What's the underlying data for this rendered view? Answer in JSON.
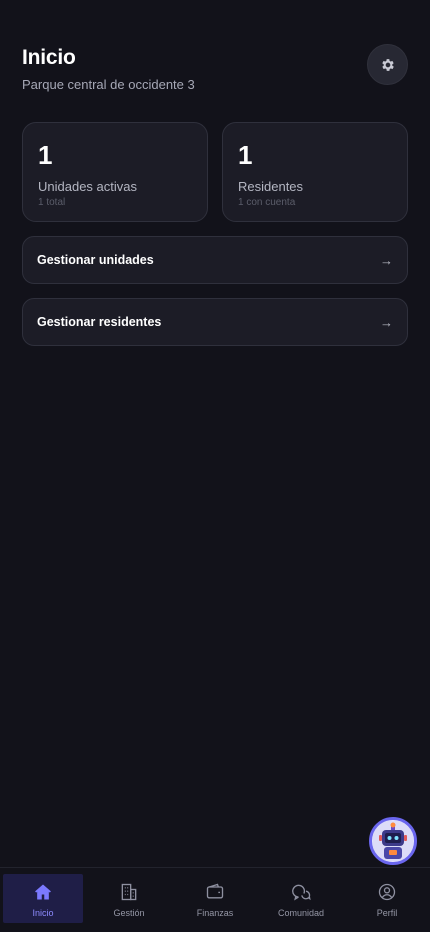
{
  "header": {
    "title": "Inicio",
    "subtitle": "Parque central de occidente 3",
    "settings_icon": "gear-icon"
  },
  "stats": [
    {
      "value": "1",
      "label": "Unidades activas",
      "sub": "1 total"
    },
    {
      "value": "1",
      "label": "Residentes",
      "sub": "1 con cuenta"
    }
  ],
  "actions": [
    {
      "label": "Gestionar unidades",
      "arrow": "→"
    },
    {
      "label": "Gestionar residentes",
      "arrow": "→"
    }
  ],
  "assistant": {
    "icon": "robot-avatar-icon"
  },
  "nav": {
    "active": "Inicio",
    "items": [
      {
        "label": "Inicio",
        "icon": "home-icon"
      },
      {
        "label": "Gestión",
        "icon": "building-icon"
      },
      {
        "label": "Finanzas",
        "icon": "wallet-icon"
      },
      {
        "label": "Comunidad",
        "icon": "chat-bubbles-icon"
      },
      {
        "label": "Perfil",
        "icon": "user-circle-icon"
      }
    ]
  },
  "colors": {
    "background": "#12121a",
    "card": "#1c1c26",
    "accent": "#6a66ee",
    "active_nav_bg": "#1f1e47"
  }
}
